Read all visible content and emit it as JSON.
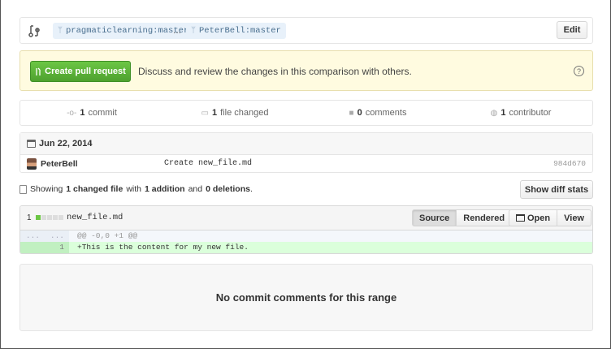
{
  "range": {
    "base_branch": "pragmaticlearning:master",
    "separator": "...",
    "head_branch": "PeterBell:master",
    "edit_label": "Edit"
  },
  "notice": {
    "button_label": "Create pull request",
    "text": "Discuss and review the changes in this comparison with others.",
    "help_icon": "?"
  },
  "stats": {
    "commits_count": "1",
    "commits_label": "commit",
    "files_count": "1",
    "files_label": "file changed",
    "comments_count": "0",
    "comments_label": "comments",
    "contributors_count": "1",
    "contributors_label": "contributor"
  },
  "commit_group": {
    "date": "Jun 22, 2014",
    "commits": [
      {
        "author": "PeterBell",
        "message": "Create new_file.md",
        "sha": "984d670"
      }
    ]
  },
  "toc": {
    "prefix": "Showing",
    "changed": "1 changed file",
    "with": "with",
    "additions": "1 addition",
    "and": "and",
    "deletions": "0 deletions",
    "suffix": ".",
    "diff_stats_label": "Show diff stats"
  },
  "file": {
    "change_count": "1",
    "bars": {
      "added": 1,
      "total": 5
    },
    "name": "new_file.md",
    "source_label": "Source",
    "rendered_label": "Rendered",
    "open_label": "Open",
    "view_label": "View",
    "hunk": {
      "left": "...",
      "right": "...",
      "text": "@@ -0,0 +1 @@"
    },
    "lines": [
      {
        "left": "",
        "right": "1",
        "text": "+This is the content for my new file."
      }
    ]
  },
  "comments": {
    "empty_text": "No commit comments for this range"
  },
  "colors": {
    "accent_green": "#6cc644",
    "notice_bg": "#fffbe0",
    "branch_bg": "#e8f1fa",
    "addition_bg": "#dbffdb"
  }
}
